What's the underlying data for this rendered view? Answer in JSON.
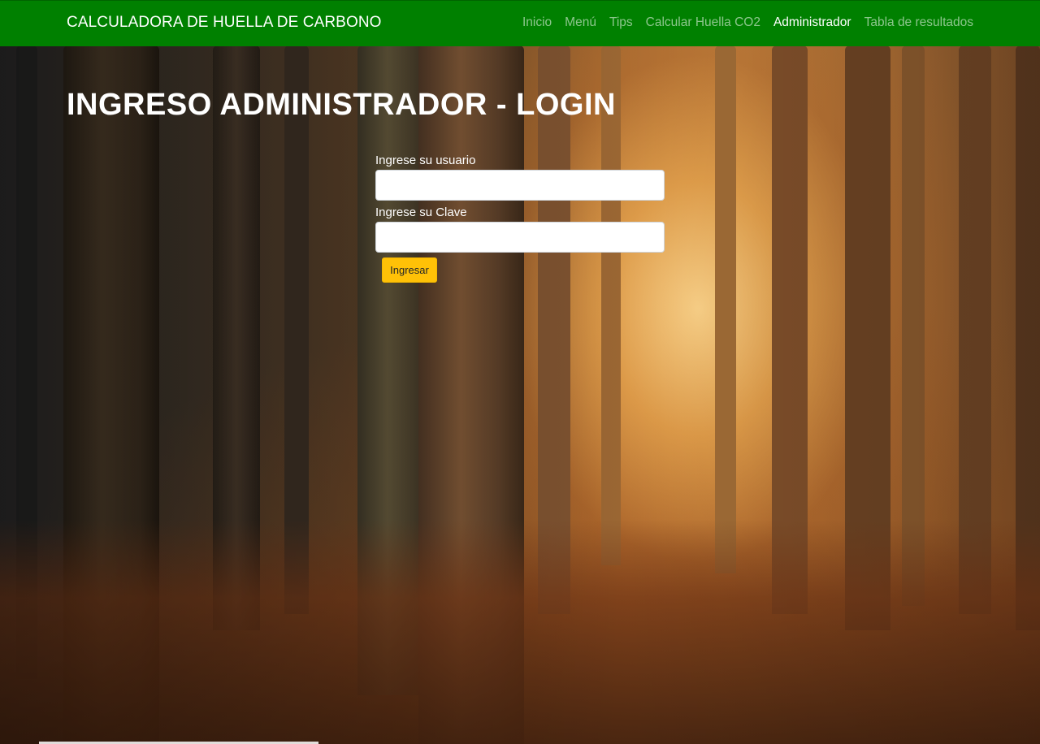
{
  "brand": "CALCULADORA DE HUELLA DE CARBONO",
  "nav": [
    {
      "label": "Inicio",
      "active": false
    },
    {
      "label": "Menú",
      "active": false
    },
    {
      "label": "Tips",
      "active": false
    },
    {
      "label": "Calcular Huella CO2",
      "active": false
    },
    {
      "label": "Administrador",
      "active": true
    },
    {
      "label": "Tabla de resultados",
      "active": false
    }
  ],
  "page_title": "INGRESO ADMINISTRADOR - LOGIN",
  "form": {
    "user_label": "Ingrese su usuario",
    "user_value": "",
    "password_label": "Ingrese su Clave",
    "password_value": "",
    "submit_label": "Ingresar"
  },
  "colors": {
    "navbar": "#008000",
    "button": "#ffc107"
  }
}
